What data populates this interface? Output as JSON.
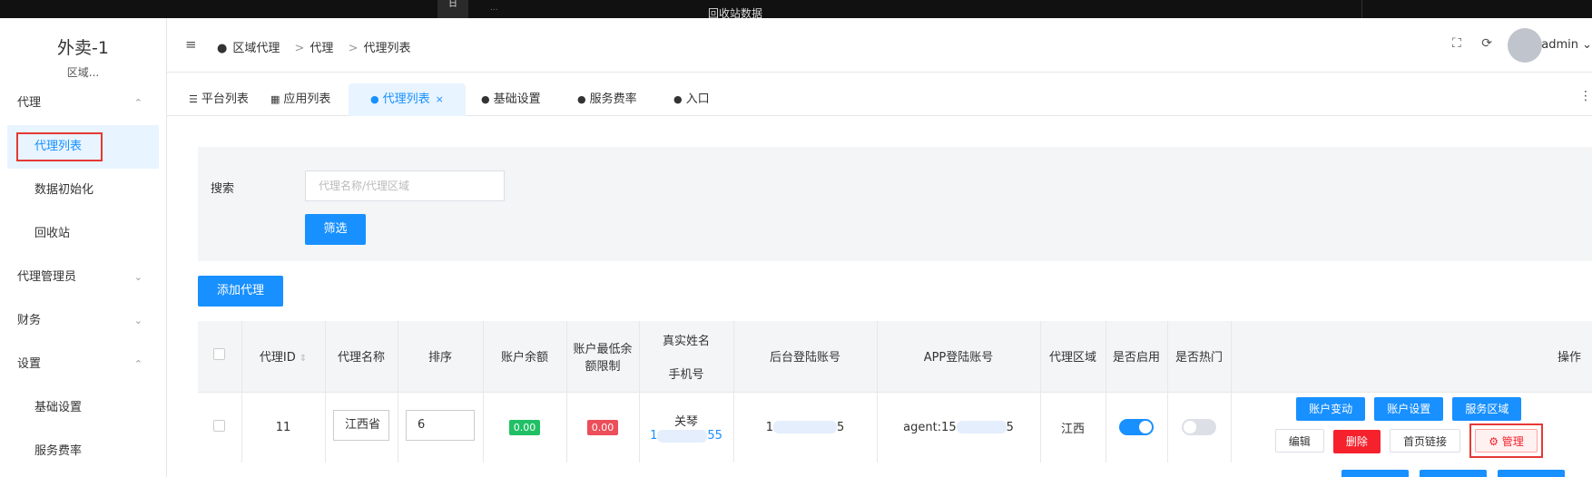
{
  "topstrip": {
    "t1": "日",
    "t2": "...",
    "t3": "回收站数据"
  },
  "sidebar": {
    "app_name": "外卖-1",
    "app_sub": "区域...",
    "menu": [
      {
        "label": "代理",
        "arrow": "^",
        "type": "group"
      },
      {
        "label": "代理列表",
        "type": "sub-active"
      },
      {
        "label": "数据初始化",
        "type": "sub"
      },
      {
        "label": "回收站",
        "type": "sub"
      },
      {
        "label": "代理管理员",
        "arrow": "v",
        "type": "group"
      },
      {
        "label": "财务",
        "arrow": "v",
        "type": "group"
      },
      {
        "label": "设置",
        "arrow": "^",
        "type": "group"
      },
      {
        "label": "基础设置",
        "type": "sub"
      },
      {
        "label": "服务费率",
        "type": "sub"
      }
    ]
  },
  "header": {
    "breadcrumb": [
      "区域代理",
      "代理",
      "代理列表"
    ],
    "user": "admin"
  },
  "tabs": [
    {
      "label": "平台列表"
    },
    {
      "label": "应用列表"
    },
    {
      "label": "代理列表",
      "active": true
    },
    {
      "label": "基础设置"
    },
    {
      "label": "服务费率"
    },
    {
      "label": "入口"
    }
  ],
  "filter": {
    "label": "搜索",
    "placeholder": "代理名称/代理区域",
    "button": "筛选"
  },
  "add_button": "添加代理",
  "table": {
    "headers": [
      "代理ID",
      "代理名称",
      "排序",
      "账户余额",
      "账户最低余额限制",
      "真实姓名",
      "手机号",
      "后台登陆账号",
      "APP登陆账号",
      "代理区域",
      "是否启用",
      "是否热门",
      "操作"
    ],
    "rows": [
      {
        "id": "11",
        "name": "江西省",
        "sort": "6",
        "balance": "0.00",
        "min_balance": "0.00",
        "real_name": "关琴",
        "phone_start": "1",
        "phone_end": "55",
        "admin_account_start": "1",
        "admin_account_end": "5",
        "app_account_start": "agent:15",
        "app_account_end": "5",
        "region": "江西",
        "enabled": true,
        "hot": false
      }
    ],
    "actions": {
      "row1": [
        "账户变动",
        "账户设置",
        "服务区域"
      ],
      "row2": [
        "编辑",
        "删除",
        "首页链接",
        "管理"
      ]
    }
  },
  "colors": {
    "primary": "#1890ff",
    "danger": "#f5222d",
    "success": "#21c065",
    "highlight": "#e53935"
  }
}
